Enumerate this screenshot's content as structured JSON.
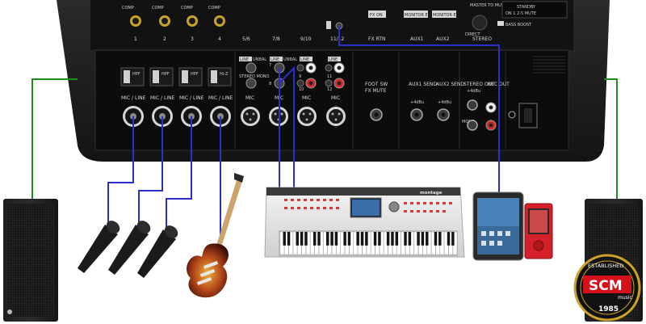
{
  "mixer": {
    "top_labels": {
      "comp1": "COMP",
      "comp2": "COMP",
      "comp3": "COMP",
      "comp4": "COMP",
      "fx_on": "FX ON",
      "monitor_eq1": "MONITOR EQ",
      "monitor_eq2": "MONITOR EQ",
      "master_to_music": "MASTER TO MUSIC",
      "direct": "DIRECT",
      "bass_boost": "BASS BOOST",
      "standby": "STANDBY",
      "standby_sub": "ON  1 2-5  MUTE"
    },
    "channel_numbers": [
      "1",
      "2",
      "3",
      "4",
      "5/6",
      "7/8",
      "9/10",
      "11/12"
    ],
    "section_labels": {
      "fx_rtn": "FX RTN",
      "aux1": "AUX1",
      "aux2": "AUX2",
      "stereo": "STEREO"
    },
    "mic_line_label": "MIC / LINE",
    "mic_label": "MIC",
    "line_label": "LINE",
    "unbal_label": "UNBAL",
    "stereo_mono": "STEREO MONO",
    "hpf": "HPF",
    "hi_z": "Hi-Z",
    "pad": "PAD",
    "foot_sw": "FOOT SW",
    "fx_mute": "FX MUTE",
    "aux1_send": "AUX1 SEND",
    "aux2_send": "AUX2 SEND",
    "stereo_out": "STEREO OUT",
    "rec_out": "REC OUT",
    "mono": "MONO",
    "plus4": "+4dBu",
    "l_r": "L(MONO)  R",
    "jack_numbers": {
      "n5": "5",
      "n6": "6",
      "n7": "7",
      "n8": "8",
      "n9": "9",
      "n10": "10",
      "n11": "11",
      "n12": "12"
    }
  },
  "keyboard": {
    "brand": "montage"
  },
  "logo": {
    "established": "ESTABLISHED",
    "scm": "SCM",
    "music": "music",
    "year": "1985"
  },
  "colors": {
    "signal_cable": "#2b2fc9",
    "speaker_cable": "#1e8f1e",
    "mixer_body": "#1c1c1c",
    "panel": "#0e0e0e",
    "logo_red": "#d4111a",
    "logo_gold": "#c9a227"
  }
}
